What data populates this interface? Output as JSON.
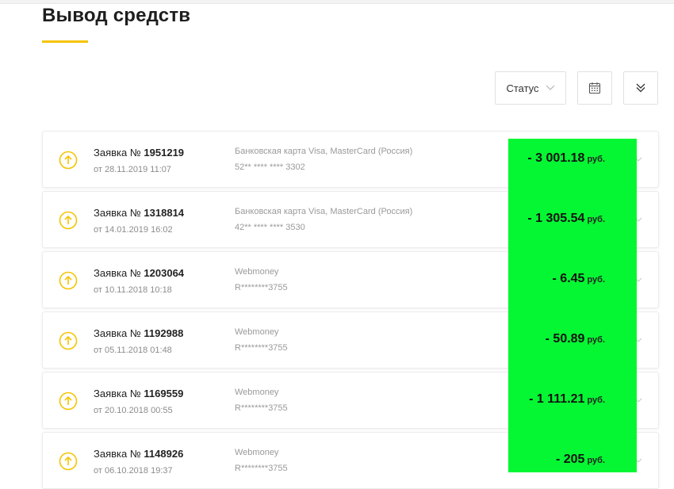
{
  "page": {
    "title": "Вывод средств",
    "accent_color": "#f5c400",
    "highlight_color": "#05f733"
  },
  "filters": {
    "status_label": "Статус",
    "status_icon": "chevron-down-icon",
    "calendar_icon": "calendar-icon",
    "expand_icon": "double-chevron-down-icon"
  },
  "request_prefix": "Заявка №",
  "date_prefix": "от",
  "currency": "руб.",
  "withdrawals": [
    {
      "number": "1951219",
      "date": "28.11.2019 11:07",
      "method": "Банковская карта Visa, MasterCard (Россия)",
      "account": "52** **** **** 3302",
      "amount": "- 3 001.18"
    },
    {
      "number": "1318814",
      "date": "14.01.2019 16:02",
      "method": "Банковская карта Visa, MasterCard (Россия)",
      "account": "42** **** **** 3530",
      "amount": "- 1 305.54"
    },
    {
      "number": "1203064",
      "date": "10.11.2018 10:18",
      "method": "Webmoney",
      "account": "R********3755",
      "amount": "- 6.45"
    },
    {
      "number": "1192988",
      "date": "05.11.2018 01:48",
      "method": "Webmoney",
      "account": "R********3755",
      "amount": "- 50.89"
    },
    {
      "number": "1169559",
      "date": "20.10.2018 00:55",
      "method": "Webmoney",
      "account": "R********3755",
      "amount": "- 1 111.21"
    },
    {
      "number": "1148926",
      "date": "06.10.2018 19:37",
      "method": "Webmoney",
      "account": "R********3755",
      "amount": "- 205"
    }
  ]
}
